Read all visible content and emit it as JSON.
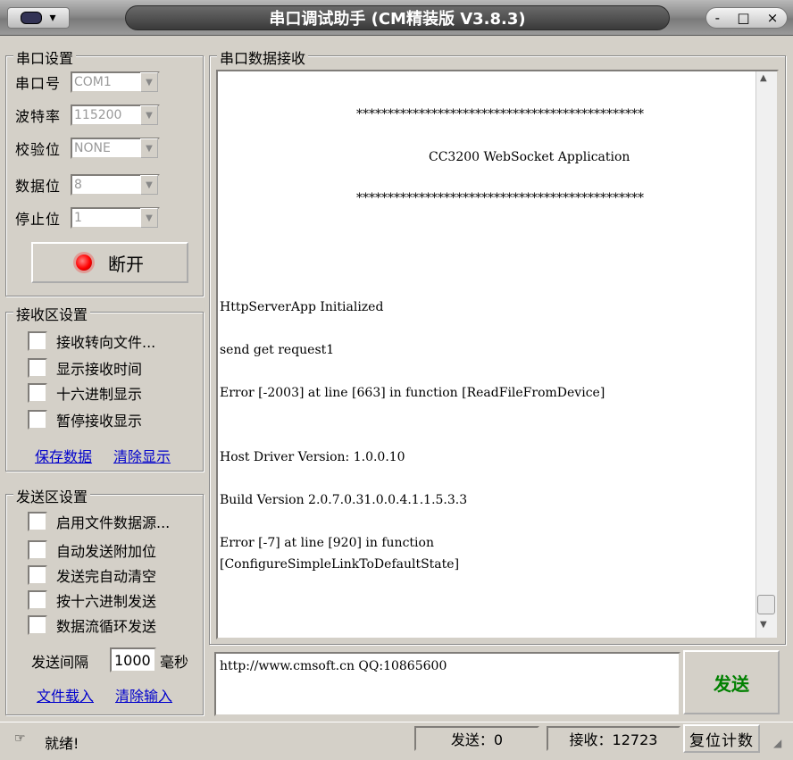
{
  "window": {
    "title": "串口调试助手 (CM精装版 V3.8.3)",
    "menu_glyph": "▾",
    "buttons": {
      "minimize": "-",
      "maximize": "□",
      "close": "×"
    }
  },
  "port_settings": {
    "title": "串口设置",
    "rows": [
      {
        "label": "串口号",
        "value": "COM1"
      },
      {
        "label": "波特率",
        "value": "115200"
      },
      {
        "label": "校验位",
        "value": "NONE"
      },
      {
        "label": "数据位",
        "value": "8"
      },
      {
        "label": "停止位",
        "value": "1"
      }
    ],
    "connect_label": "断开"
  },
  "recv_settings": {
    "title": "接收区设置",
    "options": [
      "接收转向文件...",
      "显示接收时间",
      "十六进制显示",
      "暂停接收显示"
    ],
    "save_link": "保存数据",
    "clear_link": "清除显示"
  },
  "send_settings": {
    "title": "发送区设置",
    "options": [
      "启用文件数据源...",
      "自动发送附加位",
      "发送完自动清空",
      "按十六进制发送",
      "数据流循环发送"
    ],
    "interval_label": "发送间隔",
    "interval_value": "1000",
    "interval_unit": "毫秒",
    "load_link": "文件载入",
    "clear_link": "清除输入"
  },
  "receive": {
    "title": "串口数据接收",
    "lines": [
      "**********************************************",
      "CC3200 WebSocket Application",
      "**********************************************",
      "HttpServerApp Initialized",
      "send get request1",
      "Error [-2003] at line [663] in function [ReadFileFromDevice]",
      "Host Driver Version: 1.0.0.10",
      "Build Version 2.0.7.0.31.0.0.4.1.1.5.3.3",
      "Error [-7] at line [920] in function",
      "[ConfigureSimpleLinkToDefaultState]"
    ]
  },
  "send": {
    "text": "http://www.cmsoft.cn QQ:10865600",
    "button_label": "发送"
  },
  "status": {
    "ready": "就绪!",
    "sent": "发送：0",
    "received": "接收：12723",
    "reset_label": "复位计数"
  },
  "colors": {
    "accent_green": "#008000",
    "link_blue": "#0000cc",
    "led_red": "#ff0000"
  }
}
